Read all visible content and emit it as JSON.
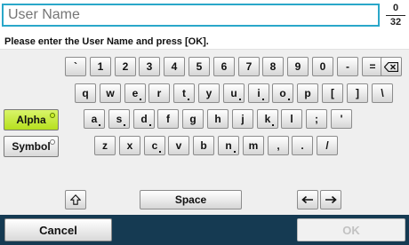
{
  "input": {
    "placeholder": "User Name",
    "value": ""
  },
  "counter": {
    "current": "0",
    "max": "32"
  },
  "instruction": "Please enter the User Name and press [OK].",
  "keyboard": {
    "row1": [
      "`",
      "1",
      "2",
      "3",
      "4",
      "5",
      "6",
      "7",
      "8",
      "9",
      "0",
      "-",
      "="
    ],
    "row2": [
      "q",
      "w",
      "e",
      "r",
      "t",
      "y",
      "u",
      "i",
      "o",
      "p",
      "[",
      "]",
      "\\"
    ],
    "row3": [
      "a",
      "s",
      "d",
      "f",
      "g",
      "h",
      "j",
      "k",
      "l",
      ";",
      "'"
    ],
    "row4": [
      "z",
      "x",
      "c",
      "v",
      "b",
      "n",
      "m",
      ",",
      ".",
      "/"
    ],
    "space_label": "Space",
    "backspace_icon": "backspace-icon",
    "shift_icon": "shift-up-icon",
    "left_icon": "arrow-left-icon",
    "right_icon": "arrow-right-icon"
  },
  "modes": {
    "alpha": "Alpha",
    "symbol": "Symbol",
    "active": "Alpha"
  },
  "footer": {
    "cancel": "Cancel",
    "ok": "OK"
  },
  "colors": {
    "input_border": "#2aa7c9",
    "active_mode": "#c7ee2a",
    "footer_bg": "#153a52"
  }
}
